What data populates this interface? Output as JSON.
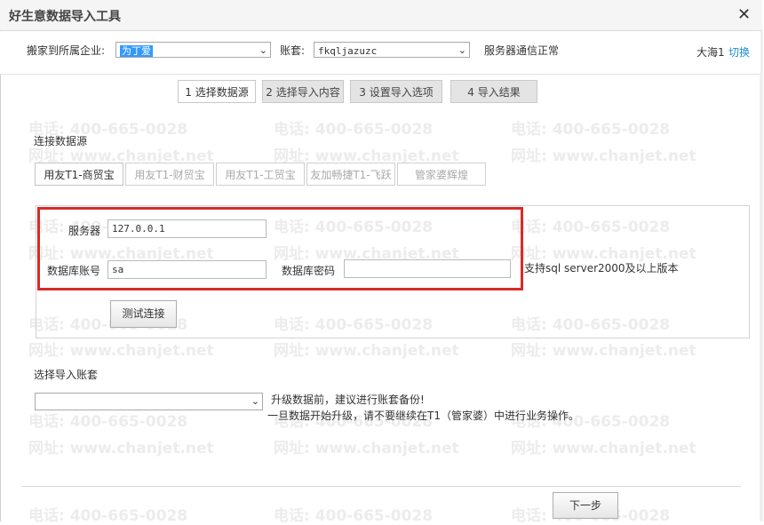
{
  "window": {
    "title": "好生意数据导入工具"
  },
  "topbar": {
    "company_label": "搬家到所属企业:",
    "company_value": "为丁爱",
    "account_label": "账套:",
    "account_value": "fkqljazuzc",
    "server_status": "服务器通信正常",
    "user_name": "大海1",
    "switch_label": "切换"
  },
  "steps": [
    {
      "label": "1 选择数据源"
    },
    {
      "label": "2 选择导入内容"
    },
    {
      "label": "3 设置导入选项"
    },
    {
      "label": "4 导入结果"
    }
  ],
  "source": {
    "section_title": "连接数据源",
    "tabs": [
      {
        "label": "用友T1-商贸宝"
      },
      {
        "label": "用友T1-财贸宝"
      },
      {
        "label": "用友T1-工贸宝"
      },
      {
        "label": "友加畅捷T1-飞跃"
      },
      {
        "label": "管家婆辉煌"
      }
    ],
    "server_label": "服务器",
    "server_value": "127.0.0.1",
    "db_account_label": "数据库账号",
    "db_account_value": "sa",
    "db_password_label": "数据库密码",
    "db_password_value": "",
    "support_note": "支持sql server2000及以上版本",
    "test_button": "测试连接"
  },
  "import_account": {
    "section_title": "选择导入账套",
    "selected": "",
    "note_line1": "升级数据前，建议进行账套备份!",
    "note_line2": "一旦数据开始升级，请不要继续在T1（管家婆）中进行业务操作。"
  },
  "footer": {
    "next_button": "下一步"
  },
  "watermark": {
    "phone": "电话: 400-665-0028",
    "site": "网址: www.chanjet.net"
  },
  "colors": {
    "highlight_box": "#d92a2a",
    "link": "#1a8fd6",
    "selection": "#3399ff"
  }
}
